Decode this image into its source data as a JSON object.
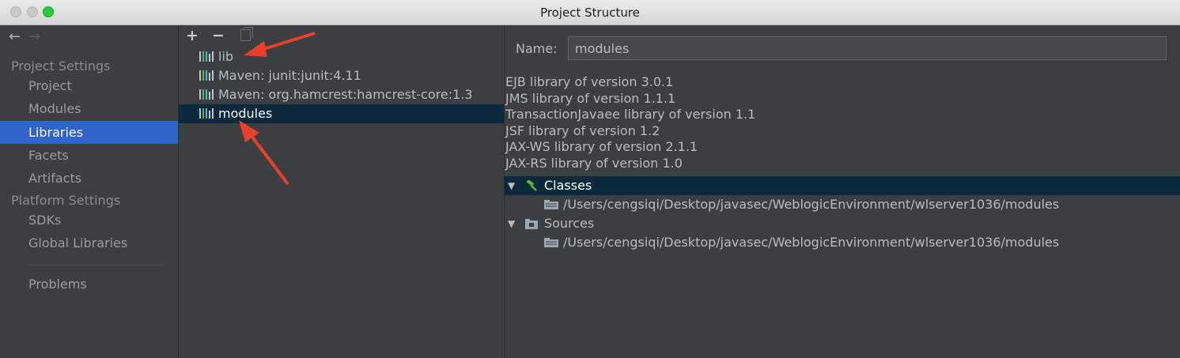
{
  "window": {
    "title": "Project Structure"
  },
  "sidebar": {
    "project_settings_header": "Project Settings",
    "platform_settings_header": "Platform Settings",
    "items": [
      {
        "label": "Project"
      },
      {
        "label": "Modules"
      },
      {
        "label": "Libraries",
        "selected": true
      },
      {
        "label": "Facets"
      },
      {
        "label": "Artifacts"
      },
      {
        "label": "SDKs"
      },
      {
        "label": "Global Libraries"
      },
      {
        "label": "Problems"
      }
    ]
  },
  "toolbar": {
    "add": "+",
    "remove": "−"
  },
  "libraries": [
    {
      "label": "lib"
    },
    {
      "label": "Maven: junit:junit:4.11"
    },
    {
      "label": "Maven: org.hamcrest:hamcrest-core:1.3"
    },
    {
      "label": "modules",
      "selected": true
    }
  ],
  "detail": {
    "name_label": "Name:",
    "name_value": "modules",
    "library_versions": [
      "EJB library of version 3.0.1",
      "JMS library of version 1.1.1",
      "TransactionJavaee library of version 1.1",
      "JSF library of version 1.2",
      "JAX-WS library of version 2.1.1",
      "JAX-RS library of version 1.0"
    ],
    "classes": {
      "label": "Classes",
      "path": "/Users/cengsiqi/Desktop/javasec/WeblogicEnvironment/wlserver1036/modules"
    },
    "sources": {
      "label": "Sources",
      "path": "/Users/cengsiqi/Desktop/javasec/WeblogicEnvironment/wlserver1036/modules"
    }
  },
  "icons": {
    "library": "library-icon",
    "classes": "hammer-icon",
    "sources": "source-folder-icon",
    "path": "jar-directory-icon",
    "expanded": "triangle-down-icon"
  },
  "colors": {
    "background": "#3c3f41",
    "selection_active": "#2f65ca",
    "selection_inactive": "#0d293e",
    "text": "#bbbbbb",
    "annotation_arrow": "#e8412b",
    "traffic_max": "#28c940"
  }
}
